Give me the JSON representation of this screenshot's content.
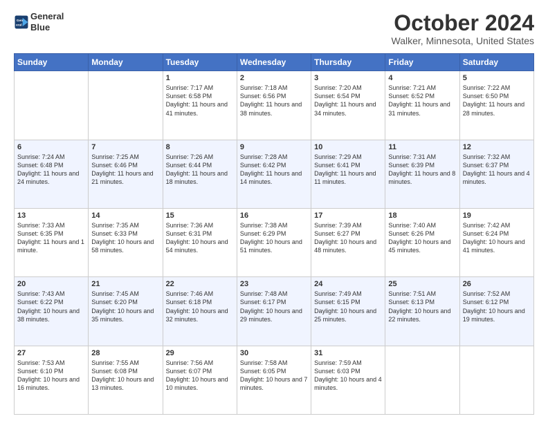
{
  "header": {
    "logo_line1": "General",
    "logo_line2": "Blue",
    "title": "October 2024",
    "subtitle": "Walker, Minnesota, United States"
  },
  "columns": [
    "Sunday",
    "Monday",
    "Tuesday",
    "Wednesday",
    "Thursday",
    "Friday",
    "Saturday"
  ],
  "weeks": [
    [
      {
        "day": "",
        "text": ""
      },
      {
        "day": "",
        "text": ""
      },
      {
        "day": "1",
        "text": "Sunrise: 7:17 AM\nSunset: 6:58 PM\nDaylight: 11 hours and 41 minutes."
      },
      {
        "day": "2",
        "text": "Sunrise: 7:18 AM\nSunset: 6:56 PM\nDaylight: 11 hours and 38 minutes."
      },
      {
        "day": "3",
        "text": "Sunrise: 7:20 AM\nSunset: 6:54 PM\nDaylight: 11 hours and 34 minutes."
      },
      {
        "day": "4",
        "text": "Sunrise: 7:21 AM\nSunset: 6:52 PM\nDaylight: 11 hours and 31 minutes."
      },
      {
        "day": "5",
        "text": "Sunrise: 7:22 AM\nSunset: 6:50 PM\nDaylight: 11 hours and 28 minutes."
      }
    ],
    [
      {
        "day": "6",
        "text": "Sunrise: 7:24 AM\nSunset: 6:48 PM\nDaylight: 11 hours and 24 minutes."
      },
      {
        "day": "7",
        "text": "Sunrise: 7:25 AM\nSunset: 6:46 PM\nDaylight: 11 hours and 21 minutes."
      },
      {
        "day": "8",
        "text": "Sunrise: 7:26 AM\nSunset: 6:44 PM\nDaylight: 11 hours and 18 minutes."
      },
      {
        "day": "9",
        "text": "Sunrise: 7:28 AM\nSunset: 6:42 PM\nDaylight: 11 hours and 14 minutes."
      },
      {
        "day": "10",
        "text": "Sunrise: 7:29 AM\nSunset: 6:41 PM\nDaylight: 11 hours and 11 minutes."
      },
      {
        "day": "11",
        "text": "Sunrise: 7:31 AM\nSunset: 6:39 PM\nDaylight: 11 hours and 8 minutes."
      },
      {
        "day": "12",
        "text": "Sunrise: 7:32 AM\nSunset: 6:37 PM\nDaylight: 11 hours and 4 minutes."
      }
    ],
    [
      {
        "day": "13",
        "text": "Sunrise: 7:33 AM\nSunset: 6:35 PM\nDaylight: 11 hours and 1 minute."
      },
      {
        "day": "14",
        "text": "Sunrise: 7:35 AM\nSunset: 6:33 PM\nDaylight: 10 hours and 58 minutes."
      },
      {
        "day": "15",
        "text": "Sunrise: 7:36 AM\nSunset: 6:31 PM\nDaylight: 10 hours and 54 minutes."
      },
      {
        "day": "16",
        "text": "Sunrise: 7:38 AM\nSunset: 6:29 PM\nDaylight: 10 hours and 51 minutes."
      },
      {
        "day": "17",
        "text": "Sunrise: 7:39 AM\nSunset: 6:27 PM\nDaylight: 10 hours and 48 minutes."
      },
      {
        "day": "18",
        "text": "Sunrise: 7:40 AM\nSunset: 6:26 PM\nDaylight: 10 hours and 45 minutes."
      },
      {
        "day": "19",
        "text": "Sunrise: 7:42 AM\nSunset: 6:24 PM\nDaylight: 10 hours and 41 minutes."
      }
    ],
    [
      {
        "day": "20",
        "text": "Sunrise: 7:43 AM\nSunset: 6:22 PM\nDaylight: 10 hours and 38 minutes."
      },
      {
        "day": "21",
        "text": "Sunrise: 7:45 AM\nSunset: 6:20 PM\nDaylight: 10 hours and 35 minutes."
      },
      {
        "day": "22",
        "text": "Sunrise: 7:46 AM\nSunset: 6:18 PM\nDaylight: 10 hours and 32 minutes."
      },
      {
        "day": "23",
        "text": "Sunrise: 7:48 AM\nSunset: 6:17 PM\nDaylight: 10 hours and 29 minutes."
      },
      {
        "day": "24",
        "text": "Sunrise: 7:49 AM\nSunset: 6:15 PM\nDaylight: 10 hours and 25 minutes."
      },
      {
        "day": "25",
        "text": "Sunrise: 7:51 AM\nSunset: 6:13 PM\nDaylight: 10 hours and 22 minutes."
      },
      {
        "day": "26",
        "text": "Sunrise: 7:52 AM\nSunset: 6:12 PM\nDaylight: 10 hours and 19 minutes."
      }
    ],
    [
      {
        "day": "27",
        "text": "Sunrise: 7:53 AM\nSunset: 6:10 PM\nDaylight: 10 hours and 16 minutes."
      },
      {
        "day": "28",
        "text": "Sunrise: 7:55 AM\nSunset: 6:08 PM\nDaylight: 10 hours and 13 minutes."
      },
      {
        "day": "29",
        "text": "Sunrise: 7:56 AM\nSunset: 6:07 PM\nDaylight: 10 hours and 10 minutes."
      },
      {
        "day": "30",
        "text": "Sunrise: 7:58 AM\nSunset: 6:05 PM\nDaylight: 10 hours and 7 minutes."
      },
      {
        "day": "31",
        "text": "Sunrise: 7:59 AM\nSunset: 6:03 PM\nDaylight: 10 hours and 4 minutes."
      },
      {
        "day": "",
        "text": ""
      },
      {
        "day": "",
        "text": ""
      }
    ]
  ]
}
